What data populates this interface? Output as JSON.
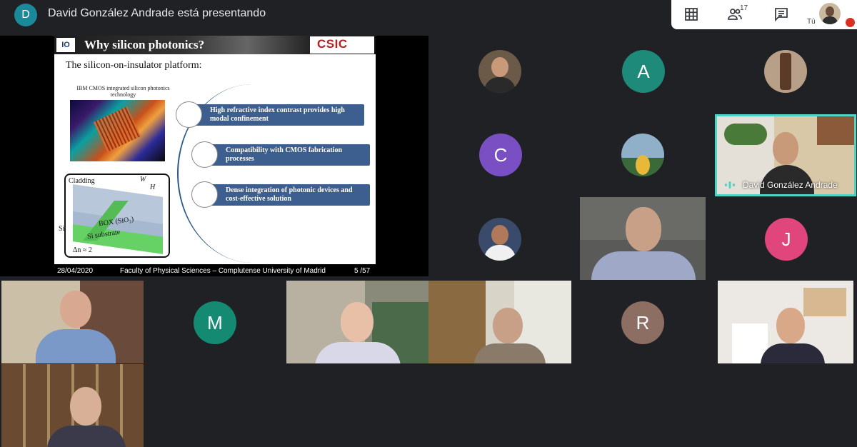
{
  "presenter": {
    "initial": "D",
    "banner": "David González Andrade está presentando"
  },
  "controls": {
    "grid_icon": "grid-view-icon",
    "people_icon": "people-icon",
    "people_count": "17",
    "chat_icon": "chat-icon",
    "self_label": "Tú",
    "self_mic": "muted"
  },
  "slide": {
    "title": "Why silicon photonics?",
    "logo_left": "IO",
    "logo_right": "CSIC",
    "subtitle": "The silicon-on-insulator platform:",
    "image_caption": "IBM CMOS integrated silicon photonics technology",
    "diagram": {
      "cladding": "Cladding",
      "w": "W",
      "h": "H",
      "box": "BOX (SiO₂)",
      "si": "Si",
      "substrate": "Si substrate",
      "delta_n": "Δn ≈ 2"
    },
    "bullets": [
      "High refractive index contrast provides high modal confinement",
      "Compatibility with CMOS fabrication processes",
      "Dense integration of photonic devices and cost-effective solution"
    ],
    "footer_date": "28/04/2020",
    "footer_center": "Faculty of Physical Sciences – Complutense University of Madrid",
    "footer_page": "5 /57"
  },
  "participants": {
    "a_initial": "A",
    "c_initial": "C",
    "j_initial": "J",
    "m_initial": "M",
    "r_initial": "R",
    "active_speaker_name": "David González Andrade"
  },
  "colors": {
    "background": "#202124",
    "active_border": "#4ed4c6",
    "a_avatar": "#1e8a7a",
    "c_avatar": "#7b4fc4",
    "j_avatar": "#e0457b",
    "m_avatar": "#148a73",
    "r_avatar": "#8d6e63"
  }
}
